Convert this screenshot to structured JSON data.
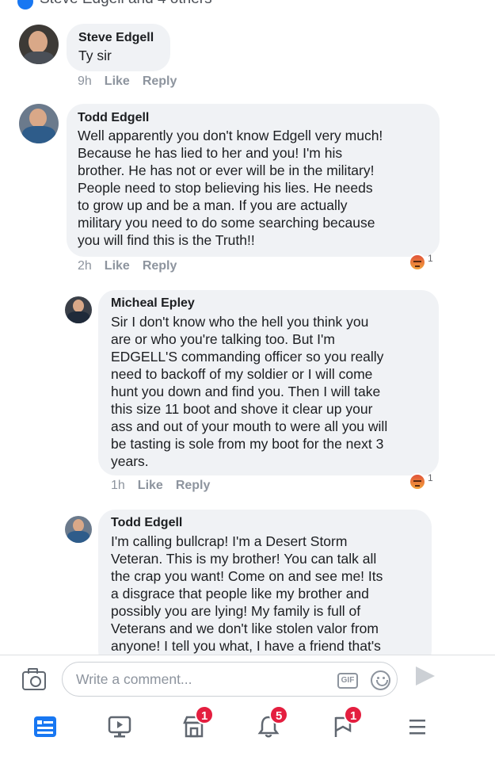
{
  "header": {
    "reacted_by": "Steve Edgell and 4 others"
  },
  "comments": [
    {
      "author": "Steve Edgell",
      "text": "Ty sir",
      "time": "9h",
      "like": "Like",
      "reply": "Reply"
    },
    {
      "author": "Todd Edgell",
      "text": "Well apparently you don't know Edgell very much!\nBecause he has lied to her and you! I'm his\nbrother. He has not or ever will be in the military!\nPeople need to stop believing his lies. He needs\nto grow up and be a man. If you are actually\nmilitary you need to do some searching because\nyou will find this is the Truth!!",
      "time": "2h",
      "like": "Like",
      "reply": "Reply",
      "reaction_count": "1",
      "reaction": "angry"
    },
    {
      "author": "Micheal Epley",
      "text": "Sir I  don't know who the hell you think you\nare or who you're talking too.  But I'm\nEDGELL'S commanding officer so you really\nneed to backoff of my soldier or I will come\nhunt you down and find you.  Then I will take\nthis size 11 boot and shove it clear up your\nass and out of your mouth to were all you will\nbe tasting is sole from my boot for the next 3\nyears.",
      "time": "1h",
      "like": "Like",
      "reply": "Reply",
      "reaction_count": "1",
      "reaction": "angry"
    },
    {
      "author": "Todd Edgell",
      "text": "I'm calling bullcrap! I'm a Desert Storm\nVeteran. This is my brother! You can talk all\nthe crap you want! Come on and see me! Its\na disgrace that people like my brother and\npossibly you are lying! My family is full of\nVeterans and we don't like stolen valor from\nanyone! I tell you what, I have a friend that's"
    }
  ],
  "composer": {
    "placeholder": "Write a comment...",
    "gif_label": "GIF"
  },
  "tabs": [
    {
      "icon": "news-feed-icon"
    },
    {
      "icon": "watch-icon"
    },
    {
      "icon": "marketplace-icon",
      "badge": "1"
    },
    {
      "icon": "notifications-icon",
      "badge": "5"
    },
    {
      "icon": "flag-icon",
      "badge": "1"
    },
    {
      "icon": "menu-icon"
    }
  ],
  "colors": {
    "accent": "#1877f2",
    "bubble": "#f0f2f5",
    "badge": "#e41e3f",
    "muted": "#8d949e"
  }
}
